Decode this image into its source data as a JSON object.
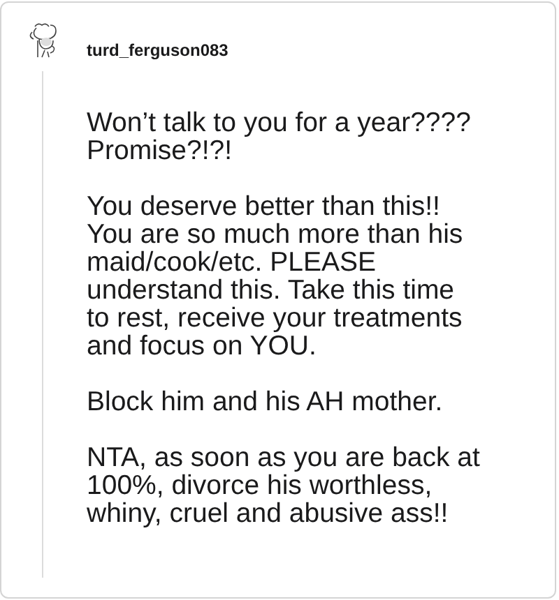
{
  "comment": {
    "author": "turd_ferguson083",
    "paragraphs": [
      [
        "Won’t talk to you for a year????",
        "Promise?!?!"
      ],
      [
        "You deserve better than this!!",
        "You are so much more than his",
        "maid/cook/etc. PLEASE",
        "understand this. Take this time",
        "to rest, receive your treatments",
        "and focus on YOU."
      ],
      [
        "Block him and his AH mother."
      ],
      [
        "NTA, as soon as you are back at",
        "100%, divorce his worthless,",
        "whiny, cruel and abusive ass!!"
      ]
    ]
  }
}
